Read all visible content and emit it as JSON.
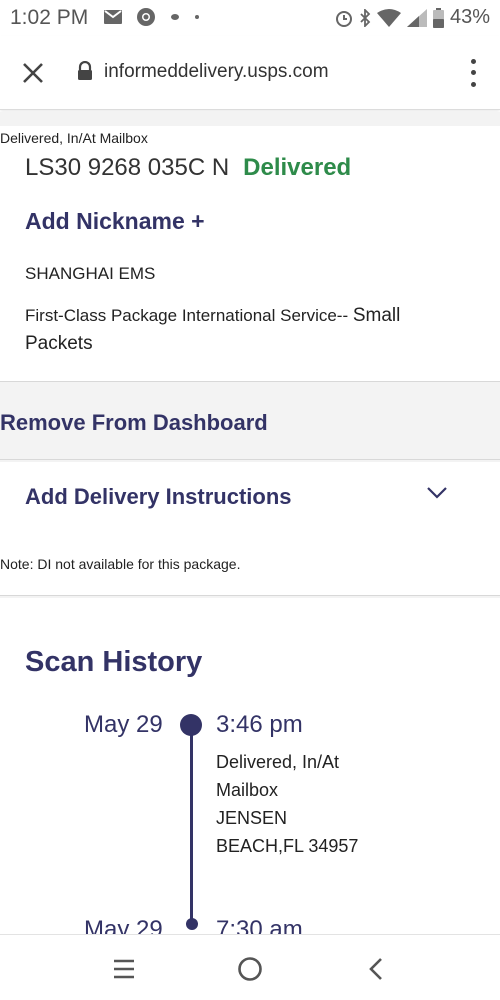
{
  "status_bar": {
    "time": "1:02 PM",
    "battery": "43%",
    "icons_left": [
      "mail-icon",
      "chrome-icon",
      "dot-icon",
      "small-dot-icon"
    ],
    "icons_right": [
      "alarm-icon",
      "bluetooth-icon",
      "wifi-icon",
      "signal-icon",
      "battery-icon"
    ]
  },
  "browser": {
    "url": "informeddelivery.usps.com"
  },
  "package": {
    "status_line": "Delivered, In/At Mailbox",
    "tracking_number": "LS30 9268 035C N",
    "status": "Delivered",
    "status_color": "#2e8b4a",
    "add_nickname": "Add Nickname +",
    "origin": "SHANGHAI EMS",
    "service_part1": "First-Class Package International Service--",
    "service_part2": "Small",
    "service_part3": "Packets"
  },
  "actions": {
    "remove_dashboard": "Remove From Dashboard",
    "delivery_instructions": "Add Delivery Instructions",
    "di_note": "Note: DI not available for this package."
  },
  "scan_history": {
    "heading": "Scan History",
    "events": [
      {
        "date": "May 29",
        "time": "3:46 pm",
        "desc_line1": "Delivered, In/At",
        "desc_line2": "Mailbox",
        "desc_line3": "JENSEN",
        "desc_line4": "BEACH,FL 34957"
      },
      {
        "date": "May 29",
        "time": "7:30 am"
      }
    ]
  },
  "colors": {
    "brand_navy": "#333366",
    "delivered_green": "#2e8b4a"
  }
}
